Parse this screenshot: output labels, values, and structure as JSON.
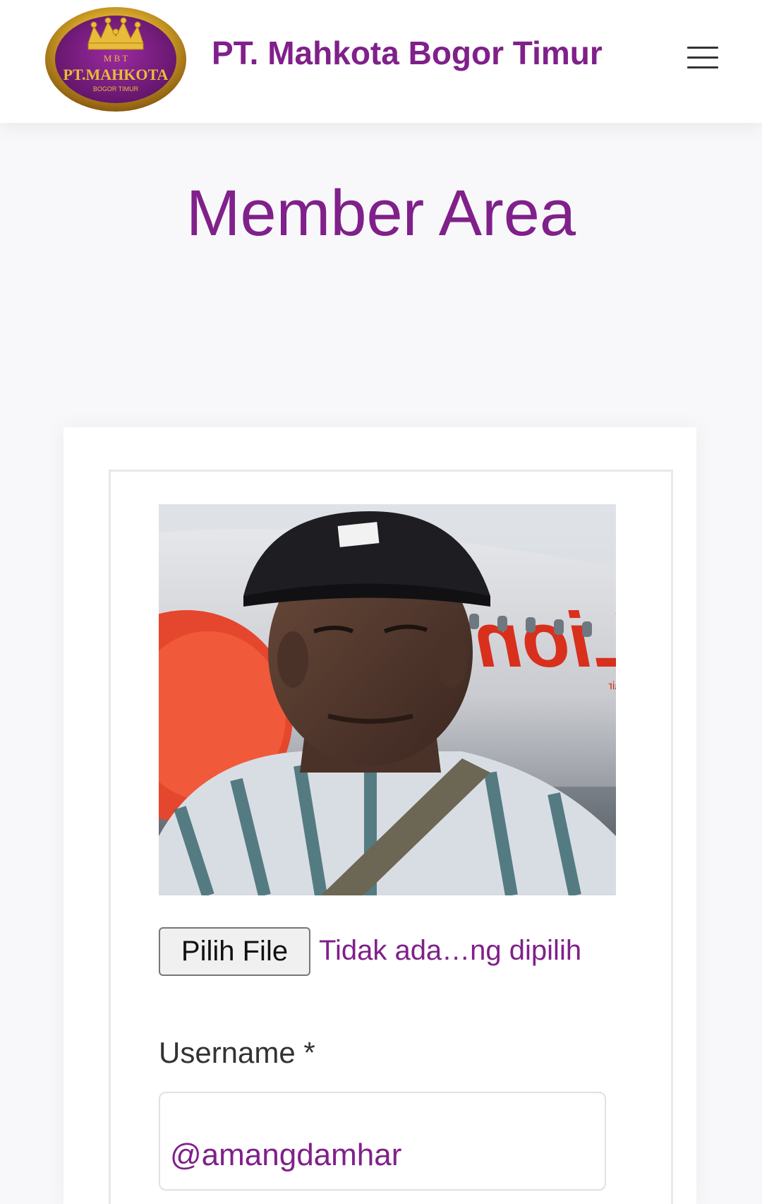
{
  "header": {
    "site_title": "PT. Mahkota Bogor Timur",
    "logo": {
      "line1": "M B T",
      "line2": "PT.MAHKOTA",
      "line3": "BOGOR TIMUR"
    },
    "menu_icon": "hamburger-menu-icon"
  },
  "main": {
    "page_title": "Member Area",
    "profile_photo": {
      "fuselage_text": "Lion",
      "fuselage_subtext": "Lion air"
    },
    "file_upload": {
      "button_label": "Pilih File",
      "status_text": "Tidak ada…ng dipilih"
    },
    "username": {
      "label": "Username *",
      "value": "@amangdamhar"
    }
  },
  "colors": {
    "brand": "#80208a",
    "gold": "#c8a028",
    "background": "#f8f8fb"
  }
}
